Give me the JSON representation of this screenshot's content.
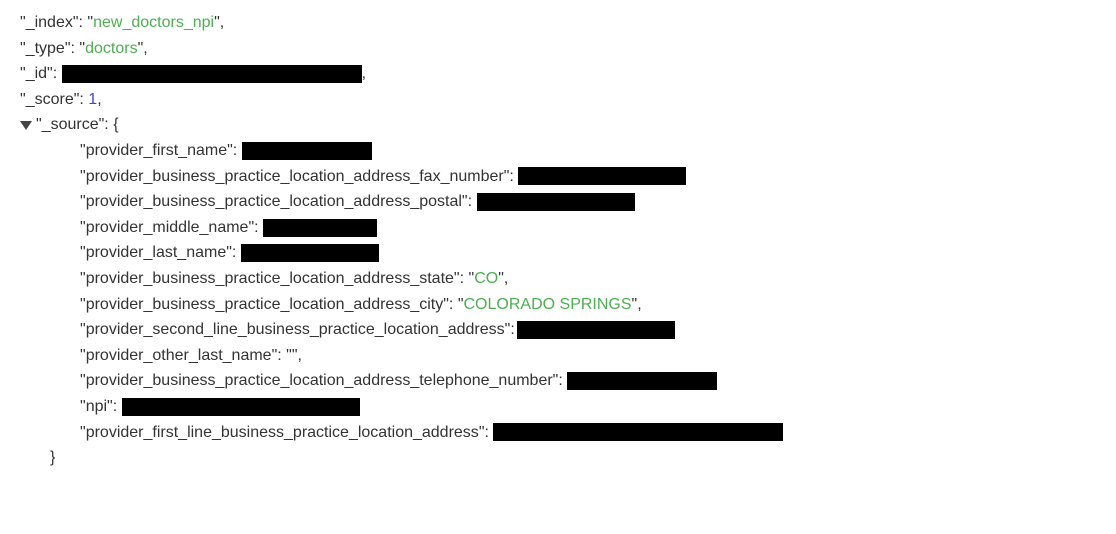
{
  "root": {
    "index_key": "_index",
    "index_value": "new_doctors_npi",
    "type_key": "_type",
    "type_value": "doctors",
    "id_key": "_id",
    "score_key": "_score",
    "score_value": 1,
    "source_key": "_source"
  },
  "source": {
    "provider_first_name_key": "provider_first_name",
    "fax_key": "provider_business_practice_location_address_fax_number",
    "postal_key": "provider_business_practice_location_address_postal",
    "middle_name_key": "provider_middle_name",
    "last_name_key": "provider_last_name",
    "state_key": "provider_business_practice_location_address_state",
    "state_value": "CO",
    "city_key": "provider_business_practice_location_address_city",
    "city_value": "COLORADO SPRINGS",
    "second_line_key": "provider_second_line_business_practice_location_address",
    "other_last_name_key": "provider_other_last_name",
    "other_last_name_value": "",
    "telephone_key": "provider_business_practice_location_address_telephone_number",
    "npi_key": "npi",
    "first_line_key": "provider_first_line_business_practice_location_address"
  }
}
